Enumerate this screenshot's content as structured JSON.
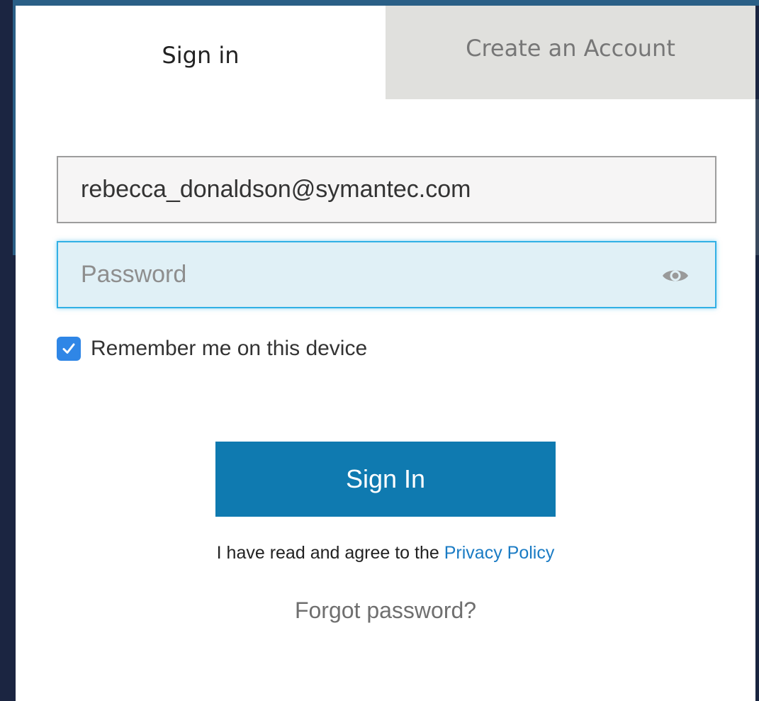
{
  "tabs": {
    "signin_label": "Sign in",
    "create_label": "Create an Account"
  },
  "form": {
    "email_value": "rebecca_donaldson@symantec.com",
    "password_placeholder": "Password",
    "remember_label": "Remember me on this device",
    "remember_checked": true,
    "signin_button_label": "Sign In",
    "agree_prefix": "I have read and agree to the ",
    "privacy_link_label": "Privacy Policy",
    "forgot_label": "Forgot password?"
  },
  "icons": {
    "eye": "eye-icon",
    "check": "checkmark-icon"
  },
  "colors": {
    "primary_button": "#0f7ab0",
    "link": "#1a7bc4",
    "checkbox": "#2f86e6",
    "focus_border": "#31b0e5",
    "inactive_tab": "#e0e0dd"
  }
}
